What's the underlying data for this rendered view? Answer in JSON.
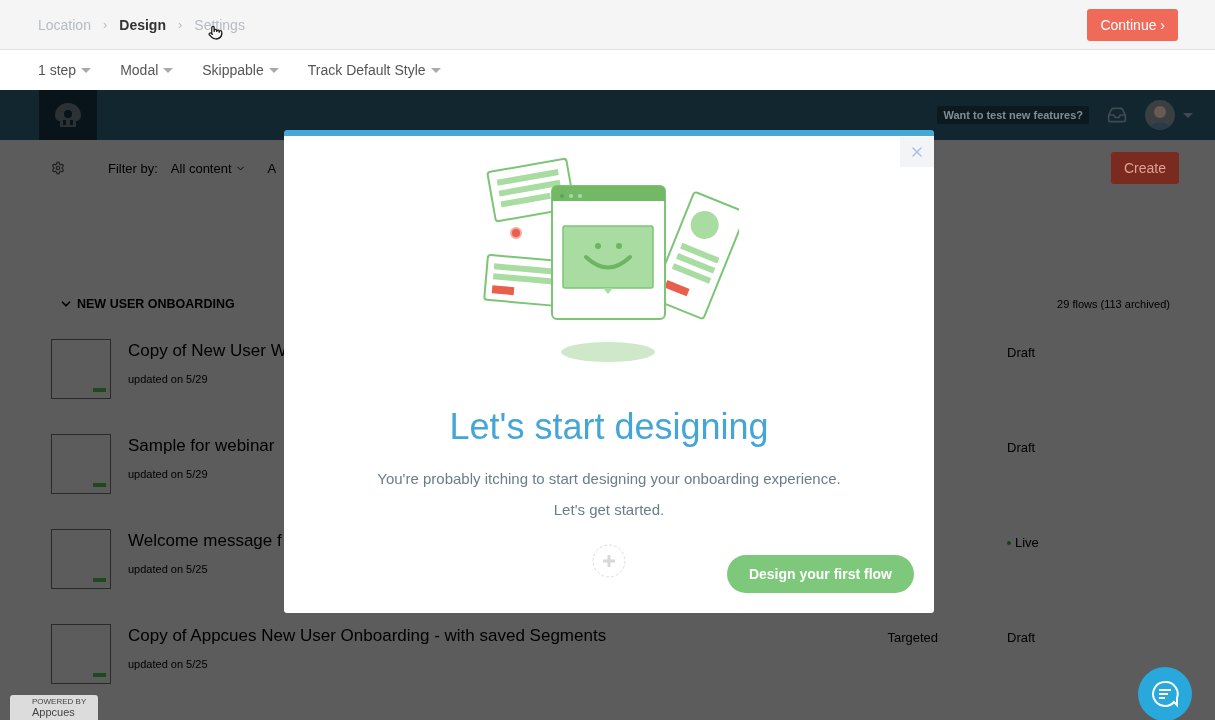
{
  "breadcrumbs": [
    {
      "label": "Location",
      "selected": false
    },
    {
      "label": "Design",
      "selected": true
    },
    {
      "label": "Settings",
      "selected": false
    }
  ],
  "breadcrumb_separator": "›",
  "continue_button": "Continue ›",
  "options": [
    "1 step",
    "Modal",
    "Skippable",
    "Track Default Style"
  ],
  "navbar": {
    "feature_badge": "Want to test new features?"
  },
  "toolbar": {
    "filter_label": "Filter by:",
    "filters": [
      {
        "label": "All content",
        "caret": true
      },
      {
        "label": "A",
        "caret": false
      }
    ],
    "create_button": "Create"
  },
  "section": {
    "title": "NEW USER ONBOARDING",
    "expanded": true,
    "count": "29 flows (113 archived)"
  },
  "flows": [
    {
      "name": "Copy of New User W",
      "updated": "updated on 5/29",
      "state": "Draft",
      "live": false
    },
    {
      "name": "Sample for webinar",
      "updated": "updated on 5/29",
      "state": "Draft",
      "live": false
    },
    {
      "name": "Welcome message f",
      "updated": "updated on 5/25",
      "state": "Live",
      "live": true
    },
    {
      "name": "Copy of Appcues New User Onboarding - with saved Segments",
      "updated": "updated on 5/25",
      "column_3": "Targeted",
      "state": "Draft",
      "live": false
    }
  ],
  "modal": {
    "title": "Let's start designing",
    "body": [
      "You're probably itching to start designing your onboarding experience.",
      "Let's get started."
    ],
    "button": "Design your first flow"
  },
  "powered_badge": {
    "line_1": "POWERED BY",
    "line_2": "Appcues"
  }
}
